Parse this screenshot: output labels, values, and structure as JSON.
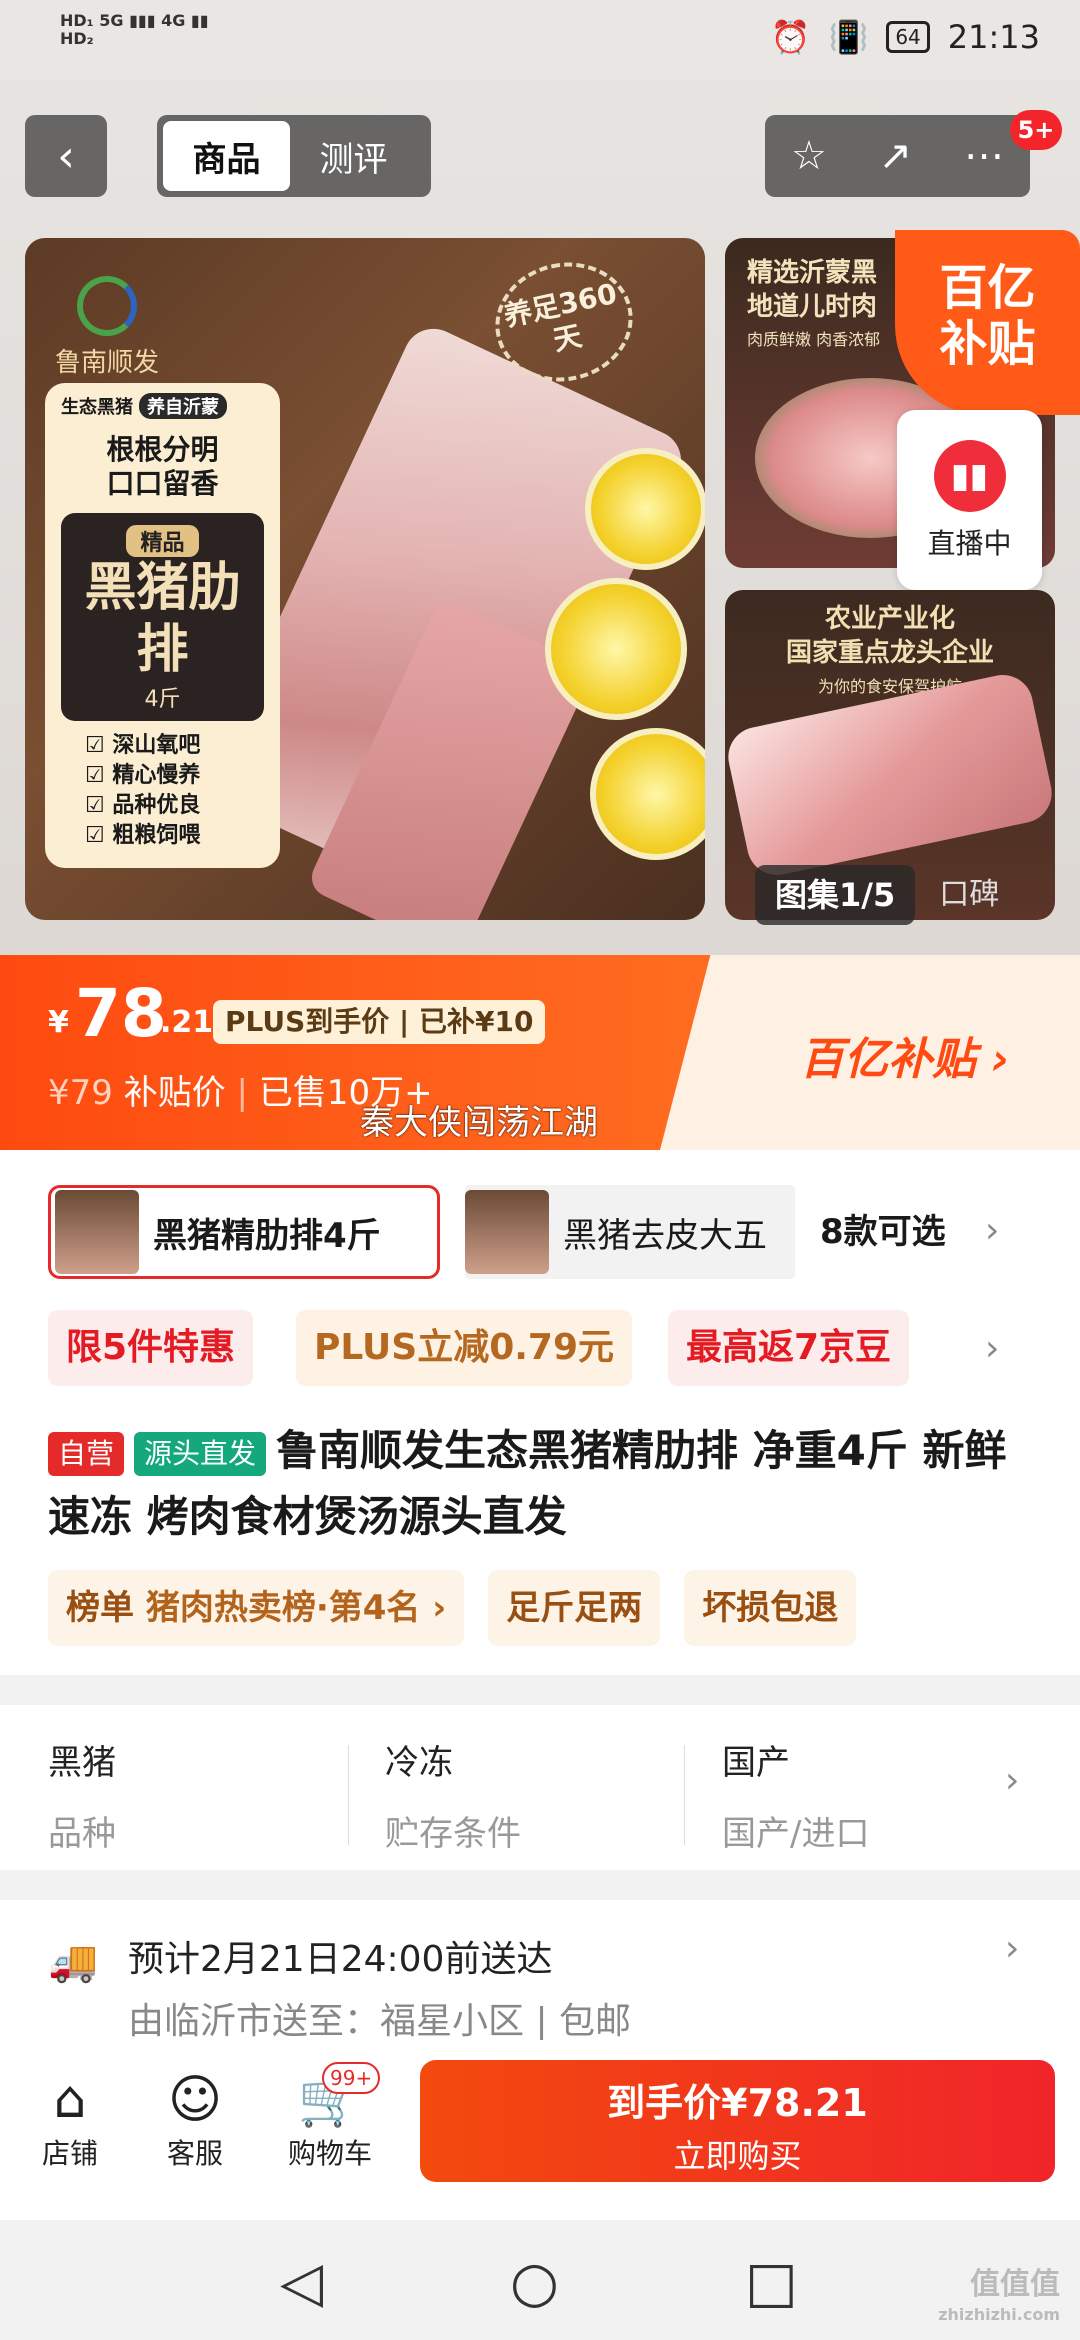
{
  "status_bar": {
    "left_top": "HD₁ 5G ▮▮▮ 4G ▮▮",
    "left_bottom": "HD₂",
    "battery": "64",
    "time": "21:13"
  },
  "nav": {
    "back": "‹",
    "tabs": [
      {
        "label": "商品"
      },
      {
        "label": "测评"
      }
    ],
    "star": "☆",
    "share": "↗",
    "more": "⋯",
    "badge": "5+"
  },
  "hero": {
    "brand": "鲁南顺发",
    "stamp": "养足360天",
    "card": {
      "tag1": "生态黑猪",
      "tag2": "养自沂蒙",
      "slogan1": "根根分明",
      "slogan2": "口口留香",
      "level": "精品",
      "big": "黑猪肋排",
      "weight": "4斤",
      "features": [
        "深山氧吧",
        "精心慢养",
        "品种优良",
        "粗粮饲喂"
      ]
    },
    "thumb1_text1": "精选沂蒙黑",
    "thumb1_text2": "地道儿时肉",
    "thumb1_sub": "肉质鲜嫩 肉香浓郁",
    "subsidy_corner1": "百亿",
    "subsidy_corner2": "补贴",
    "live_label": "直播中",
    "thumb2_text1": "农业产业化",
    "thumb2_text2": "国家重点龙头企业",
    "thumb2_sub": "为你的食安保驾护航",
    "gallery_label": "图集1/5",
    "reviews_label": "口碑"
  },
  "price": {
    "currency": "¥",
    "integer": "78",
    "decimal": ".21",
    "plus_tag": "PLUS到手价 | 已补¥10",
    "original": "¥79",
    "subsidy_label": "补贴价",
    "sold": "已售10万+",
    "watermark": "秦大侠闯荡江湖",
    "program": "百亿补贴 ›"
  },
  "sku": {
    "selected": "黑猪精肋排4斤",
    "other": "黑猪去皮大五",
    "count": "8款可选"
  },
  "promos": [
    "限5件特惠",
    "PLUS立减0.79元",
    "最高返7京豆"
  ],
  "product": {
    "tag_self": "自营",
    "tag_source": "源头直发",
    "title": "鲁南顺发生态黑猪精肋排 净重4斤 新鲜速冻 烤肉食材煲汤源头直发"
  },
  "chips": {
    "rank_prefix": "榜单",
    "rank_text": "猪肉热卖榜·第4名 ›",
    "chip2": "足斤足两",
    "chip3": "坏损包退"
  },
  "specs": [
    {
      "value": "黑猪",
      "key": "品种"
    },
    {
      "value": "冷冻",
      "key": "贮存条件"
    },
    {
      "value": "国产",
      "key": "国产/进口"
    }
  ],
  "delivery": {
    "line1": "预计2月21日24:00前送达",
    "line2": "由临沂市送至：福星小区 | 包邮"
  },
  "bottom_bar": {
    "shop": "店铺",
    "service": "客服",
    "cart": "购物车",
    "cart_badge": "99+",
    "buy_line1": "到手价¥78.21",
    "buy_line2": "立即购买"
  },
  "sysnav": {
    "back": "◁",
    "home": "○",
    "recents": "□"
  },
  "corner_watermark": "值值值",
  "corner_watermark_sub": "zhizhizhi.com",
  "colors": {
    "accent": "#ff4a12",
    "red": "#e52a2a",
    "green": "#14a87c"
  }
}
